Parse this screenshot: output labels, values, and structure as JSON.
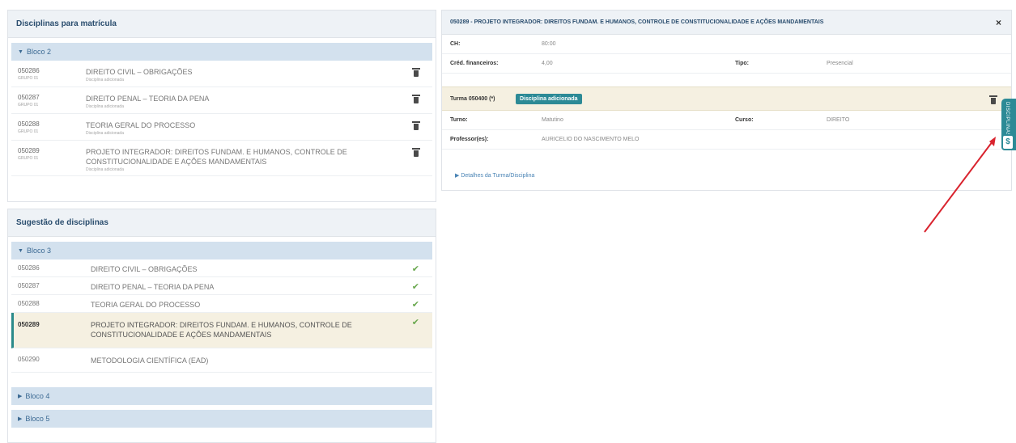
{
  "matricula": {
    "title": "Disciplinas para matrícula",
    "bloco": "Bloco 2",
    "items": [
      {
        "code": "050286",
        "sub": "GRUPO 01",
        "name": "DIREITO CIVIL – OBRIGAÇÕES",
        "subname": "Disciplina adicionada"
      },
      {
        "code": "050287",
        "sub": "GRUPO 01",
        "name": "DIREITO PENAL – TEORIA DA PENA",
        "subname": "Disciplina adicionada"
      },
      {
        "code": "050288",
        "sub": "GRUPO 01",
        "name": "TEORIA GERAL DO PROCESSO",
        "subname": "Disciplina adicionada"
      },
      {
        "code": "050289",
        "sub": "GRUPO 01",
        "name": "PROJETO INTEGRADOR: DIREITOS FUNDAM. E HUMANOS, CONTROLE DE CONSTITUCIONALIDADE E AÇÕES MANDAMENTAIS",
        "subname": "Disciplina adicionada"
      }
    ]
  },
  "sugestao": {
    "title": "Sugestão de disciplinas",
    "bloco": "Bloco 3",
    "items": [
      {
        "code": "050286",
        "name": "DIREITO CIVIL – OBRIGAÇÕES"
      },
      {
        "code": "050287",
        "name": "DIREITO PENAL – TEORIA DA PENA"
      },
      {
        "code": "050288",
        "name": "TEORIA GERAL DO PROCESSO"
      },
      {
        "code": "050289",
        "name": "PROJETO INTEGRADOR: DIREITOS FUNDAM. E HUMANOS, CONTROLE DE CONSTITUCIONALIDADE E AÇÕES MANDAMENTAIS"
      },
      {
        "code": "050290",
        "name": "METODOLOGIA CIENTÍFICA (EAD)"
      }
    ],
    "bloco4": "Bloco 4",
    "bloco5": "Bloco 5"
  },
  "detail": {
    "title": "050289 - PROJETO INTEGRADOR: DIREITOS FUNDAM. E HUMANOS, CONTROLE DE CONSTITUCIONALIDADE E AÇÕES MANDAMENTAIS",
    "close": "×",
    "ch_label": "CH:",
    "ch_value": "80:00",
    "cred_label": "Créd. financeiros:",
    "cred_value": "4,00",
    "tipo_label": "Tipo:",
    "tipo_value": "Presencial",
    "turma_label": "Turma 050400 (*)",
    "turma_badge": "Disciplina adicionada",
    "turno_label": "Turno:",
    "turno_value": "Matutino",
    "curso_label": "Curso:",
    "curso_value": "DIREITO",
    "prof_label": "Professor(es):",
    "prof_value": "AURICELIO DO NASCIMENTO MELO",
    "detalhes": "▶  Detalhes da Turma/Disciplina"
  },
  "side": {
    "tab_text": "DISCIPLINAS",
    "btn": "$"
  },
  "colors": {
    "accent": "#2c8a96",
    "arrow": "#d9232e",
    "bloco_bg": "#d3e1ee",
    "highlight": "#f5f0e1"
  }
}
